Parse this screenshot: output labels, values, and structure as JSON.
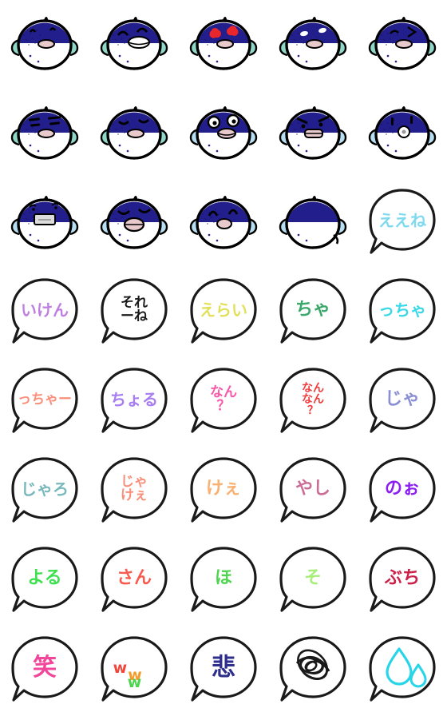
{
  "sheet": {
    "title": "Pufferfish Hiroshima dialect emoji sheet",
    "columns": 5,
    "rows": 8,
    "background_color": "#ffffff"
  },
  "palette": {
    "body_navy": "#221f8c",
    "body_white": "#ffffff",
    "outline": "#000000",
    "fin_mint": "#8fd8c8",
    "fin_blue": "#b8dff0",
    "mouth_pink": "#e8c9cc",
    "heart_red": "#e8262c",
    "bubble_fill": "#ffffff",
    "bubble_outline": "#1a1a1a"
  },
  "stickers": [
    {
      "id": 1,
      "kind": "face",
      "name": "pufferfish-neutral-brows",
      "face": "browline",
      "text": "",
      "color": ""
    },
    {
      "id": 2,
      "kind": "face",
      "name": "pufferfish-smiling",
      "face": "smile",
      "text": "",
      "color": ""
    },
    {
      "id": 3,
      "kind": "face",
      "name": "pufferfish-heart-eyes",
      "face": "hearts",
      "text": "",
      "color": ""
    },
    {
      "id": 4,
      "kind": "face",
      "name": "pufferfish-side-eyes",
      "face": "sideeyes",
      "text": "",
      "color": ""
    },
    {
      "id": 5,
      "kind": "face",
      "name": "pufferfish-wink",
      "face": "wink",
      "text": "",
      "color": ""
    },
    {
      "id": 6,
      "kind": "face",
      "name": "pufferfish-sleepy-lines",
      "face": "sleepy",
      "text": "",
      "color": ""
    },
    {
      "id": 7,
      "kind": "face",
      "name": "pufferfish-closed-eyes",
      "face": "closed",
      "text": "",
      "color": ""
    },
    {
      "id": 8,
      "kind": "face",
      "name": "pufferfish-surprised",
      "face": "surprised",
      "text": "",
      "color": ""
    },
    {
      "id": 9,
      "kind": "face",
      "name": "pufferfish-angry",
      "face": "angry",
      "text": "",
      "color": ""
    },
    {
      "id": 10,
      "kind": "face",
      "name": "pufferfish-dizzy-eye",
      "face": "dizzy",
      "text": "",
      "color": ""
    },
    {
      "id": 11,
      "kind": "face",
      "name": "pufferfish-masked",
      "face": "mask",
      "text": "",
      "color": ""
    },
    {
      "id": 12,
      "kind": "face",
      "name": "pufferfish-yawning",
      "face": "yawn",
      "text": "",
      "color": ""
    },
    {
      "id": 13,
      "kind": "face",
      "name": "pufferfish-sad",
      "face": "sad",
      "text": "",
      "color": ""
    },
    {
      "id": 14,
      "kind": "face",
      "name": "pufferfish-facing-away",
      "face": "away",
      "text": "",
      "color": ""
    },
    {
      "id": 15,
      "kind": "bubble",
      "name": "bubble-eene",
      "face": "",
      "text": "ええね",
      "color": "#7fd9ef"
    },
    {
      "id": 16,
      "kind": "bubble",
      "name": "bubble-iken",
      "face": "",
      "text": "いけん",
      "color": "#c07fe0"
    },
    {
      "id": 17,
      "kind": "bubble",
      "name": "bubble-sore-ne",
      "face": "",
      "text": "それ\nーね",
      "color": "#1a1a1a"
    },
    {
      "id": 18,
      "kind": "bubble",
      "name": "bubble-erai",
      "face": "",
      "text": "えらい",
      "color": "#e2e05a"
    },
    {
      "id": 19,
      "kind": "bubble",
      "name": "bubble-cha",
      "face": "",
      "text": "ちゃ",
      "color": "#3aa86a"
    },
    {
      "id": 20,
      "kind": "bubble",
      "name": "bubble-ccha",
      "face": "",
      "text": "っちゃ",
      "color": "#3ad9e8"
    },
    {
      "id": 21,
      "kind": "bubble",
      "name": "bubble-cchaa",
      "face": "",
      "text": "っちゃー",
      "color": "#f98f7a"
    },
    {
      "id": 22,
      "kind": "bubble",
      "name": "bubble-choru",
      "face": "",
      "text": "ちょる",
      "color": "#a77ef0"
    },
    {
      "id": 23,
      "kind": "bubble",
      "name": "bubble-nan-q",
      "face": "",
      "text": "なん\n？",
      "color": "#f759a8"
    },
    {
      "id": 24,
      "kind": "bubble",
      "name": "bubble-nan-nan-q",
      "face": "",
      "text": "なん\nなん\n？",
      "color": "#f03b3b"
    },
    {
      "id": 25,
      "kind": "bubble",
      "name": "bubble-ja",
      "face": "",
      "text": "じゃ",
      "color": "#8b8fd4"
    },
    {
      "id": 26,
      "kind": "bubble",
      "name": "bubble-jaro",
      "face": "",
      "text": "じゃろ",
      "color": "#79b8bd"
    },
    {
      "id": 27,
      "kind": "bubble",
      "name": "bubble-jakee",
      "face": "",
      "text": "じゃ\nけぇ",
      "color": "#f98f7a"
    },
    {
      "id": 28,
      "kind": "bubble",
      "name": "bubble-kee",
      "face": "",
      "text": "けぇ",
      "color": "#f9b071"
    },
    {
      "id": 29,
      "kind": "bubble",
      "name": "bubble-yashi",
      "face": "",
      "text": "やし",
      "color": "#cb6e97"
    },
    {
      "id": 30,
      "kind": "bubble",
      "name": "bubble-noo",
      "face": "",
      "text": "のぉ",
      "color": "#8b1ef0"
    },
    {
      "id": 31,
      "kind": "bubble",
      "name": "bubble-yoru",
      "face": "",
      "text": "よる",
      "color": "#3ee04f"
    },
    {
      "id": 32,
      "kind": "bubble",
      "name": "bubble-san",
      "face": "",
      "text": "さん",
      "color": "#f75a4e"
    },
    {
      "id": 33,
      "kind": "bubble",
      "name": "bubble-ho",
      "face": "",
      "text": "ほ",
      "color": "#4fd44f"
    },
    {
      "id": 34,
      "kind": "bubble",
      "name": "bubble-so",
      "face": "",
      "text": "そ",
      "color": "#a8ee7a"
    },
    {
      "id": 35,
      "kind": "bubble",
      "name": "bubble-buchi",
      "face": "",
      "text": "ぶち",
      "color": "#cb2048"
    },
    {
      "id": 36,
      "kind": "bubble",
      "name": "bubble-warai-kanji",
      "face": "",
      "text": "笑",
      "color": "#f0479b"
    },
    {
      "id": 37,
      "kind": "bubble-www",
      "name": "bubble-www",
      "face": "",
      "text": "www",
      "color": "#f0473b",
      "www_colors": [
        "#f0473b",
        "#f59b2a",
        "#4fd44f"
      ]
    },
    {
      "id": 38,
      "kind": "bubble",
      "name": "bubble-kanashii-kanji",
      "face": "",
      "text": "悲",
      "color": "#2e2f8c"
    },
    {
      "id": 39,
      "kind": "bubble-scribble",
      "name": "bubble-scribble",
      "face": "",
      "text": "",
      "color": "#1a1a1a"
    },
    {
      "id": 40,
      "kind": "bubble-tears",
      "name": "bubble-sweat-drops",
      "face": "",
      "text": "",
      "color": "#26d6e8"
    }
  ]
}
